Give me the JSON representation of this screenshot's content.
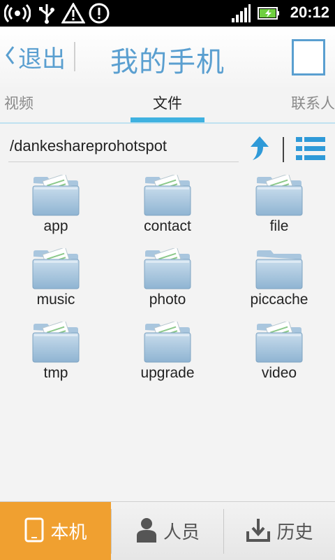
{
  "status_bar": {
    "time": "20:12"
  },
  "header": {
    "back_label": "退出",
    "title": "我的手机"
  },
  "tabs": [
    {
      "label": "视频"
    },
    {
      "label": "文件"
    },
    {
      "label": "联系人"
    }
  ],
  "path": {
    "current": "/dankeshareprohotspot"
  },
  "files": [
    {
      "name": "app",
      "has_content": true
    },
    {
      "name": "contact",
      "has_content": true
    },
    {
      "name": "file",
      "has_content": true
    },
    {
      "name": "music",
      "has_content": true
    },
    {
      "name": "photo",
      "has_content": true
    },
    {
      "name": "piccache",
      "has_content": false
    },
    {
      "name": "tmp",
      "has_content": true
    },
    {
      "name": "upgrade",
      "has_content": true
    },
    {
      "name": "video",
      "has_content": true
    }
  ],
  "bottom_nav": [
    {
      "label": "本机",
      "icon": "tablet-icon",
      "selected": true
    },
    {
      "label": "人员",
      "icon": "person-icon",
      "selected": false
    },
    {
      "label": "历史",
      "icon": "download-icon",
      "selected": false
    }
  ],
  "colors": {
    "accent": "#5a9fd0",
    "tab_indicator": "#3fb1e0",
    "selected_nav": "#f0a030"
  }
}
